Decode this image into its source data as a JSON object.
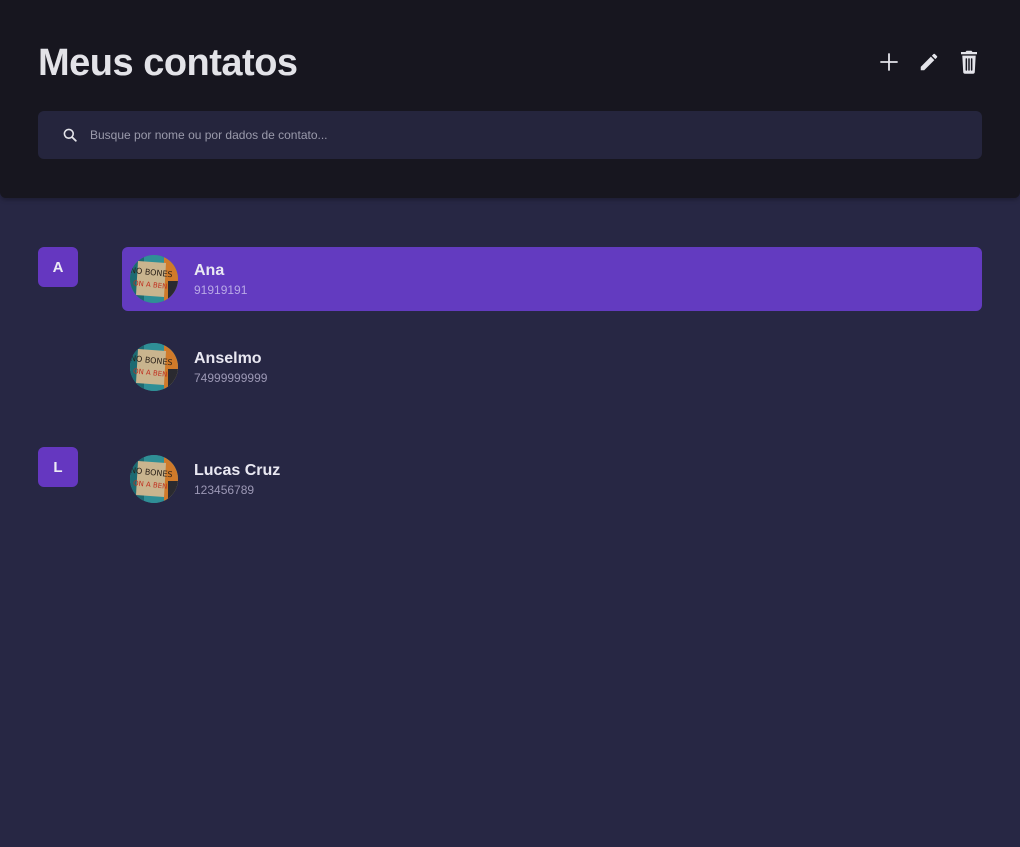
{
  "header": {
    "title": "Meus contatos",
    "actions": [
      {
        "name": "add",
        "icon": "plus-icon"
      },
      {
        "name": "edit",
        "icon": "pencil-icon"
      },
      {
        "name": "delete",
        "icon": "trash-icon"
      }
    ]
  },
  "search": {
    "placeholder": "Busque por nome ou por dados de contato...",
    "value": "",
    "icon": "search-icon"
  },
  "groups": [
    {
      "letter": "A",
      "contacts": [
        {
          "name": "Ana",
          "phone": "91919191",
          "selected": true
        },
        {
          "name": "Anselmo",
          "phone": "74999999999",
          "selected": false
        }
      ]
    },
    {
      "letter": "L",
      "contacts": [
        {
          "name": "Lucas Cruz",
          "phone": "123456789",
          "selected": false
        }
      ]
    }
  ],
  "colors": {
    "header_bg": "#17161f",
    "page_bg": "#272744",
    "accent": "#6537c0",
    "selected_row": "#633bc0",
    "search_bg": "#25253d"
  }
}
